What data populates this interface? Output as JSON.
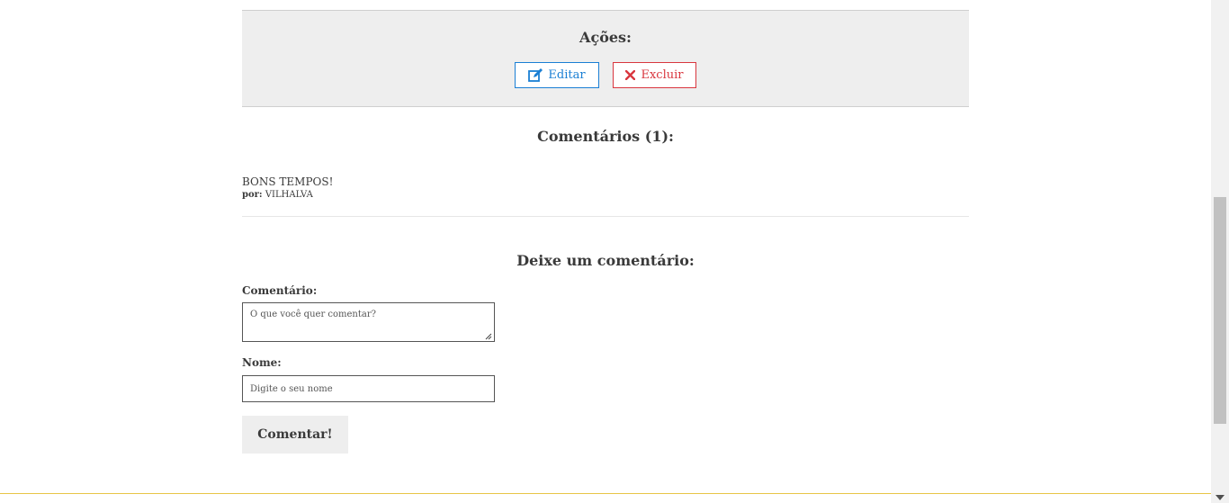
{
  "actions": {
    "title": "Ações:",
    "edit_label": "Editar",
    "delete_label": "Excluir",
    "edit_icon": "edit-icon",
    "delete_icon": "close-icon"
  },
  "comments": {
    "title": "Comentários (1):",
    "items": [
      {
        "text": "BONS TEMPOS!",
        "by_label": "por:",
        "author": "VILHALVA"
      }
    ]
  },
  "form": {
    "title": "Deixe um comentário:",
    "comment_label": "Comentário:",
    "comment_placeholder": "O que você quer comentar?",
    "name_label": "Nome:",
    "name_placeholder": "Digite o seu nome",
    "submit_label": "Comentar!"
  },
  "colors": {
    "edit": "#1a7fd4",
    "delete": "#d9363e",
    "footer_accent": "#e8c547",
    "panel_bg": "#eeeeee"
  }
}
